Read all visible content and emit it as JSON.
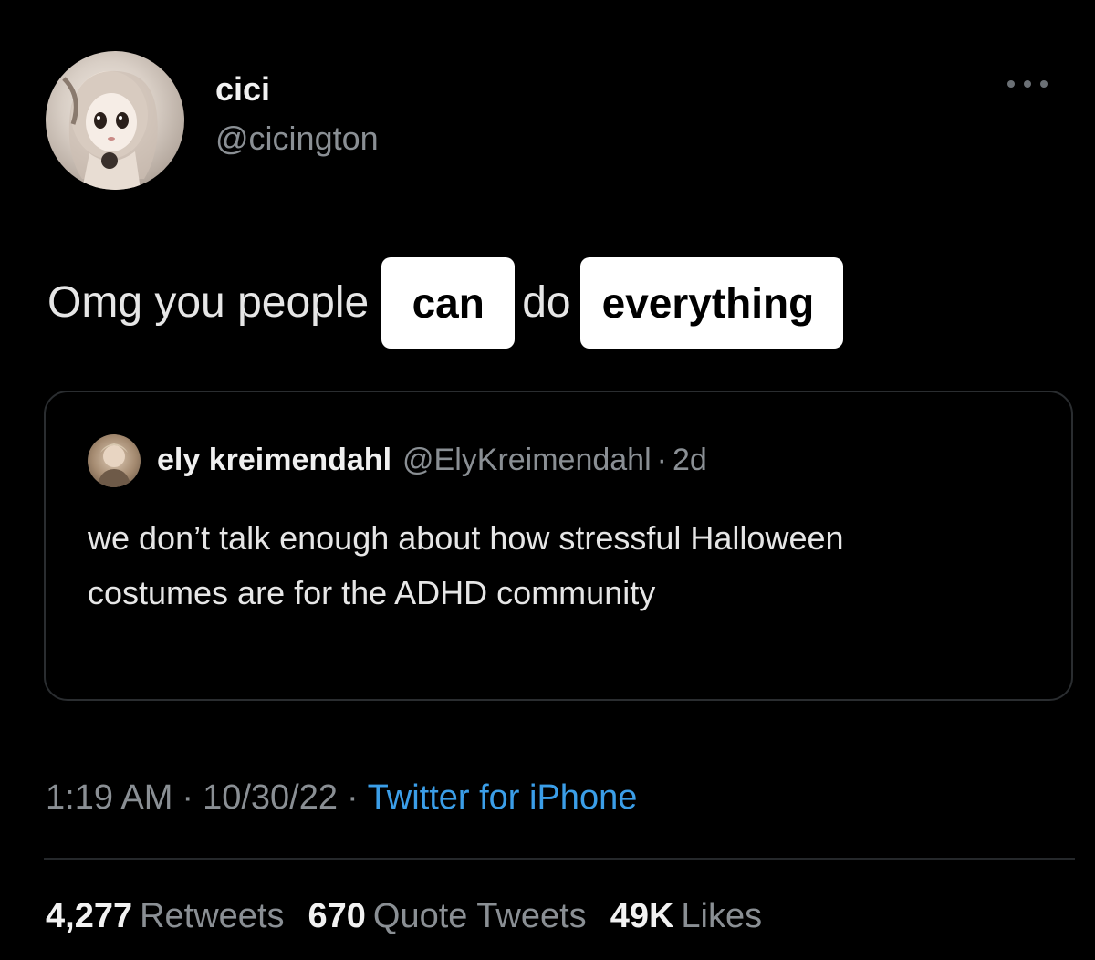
{
  "tweet": {
    "author": {
      "name": "cici",
      "handle": "@cicington",
      "avatar_icon": "avatar-photo"
    },
    "more_icon": "more-options-icon",
    "text": {
      "part1": "Omg you people",
      "highlight1": "can",
      "part2": "do",
      "highlight2": "everything"
    },
    "quoted": {
      "name": "ely kreimendahl",
      "handle": "@ElyKreimendahl",
      "separator": "·",
      "time": "2d",
      "body": "we don’t talk enough about how stressful Halloween costumes are for the ADHD community"
    },
    "meta": {
      "time": "1:19 AM",
      "dot1": "·",
      "date": "10/30/22",
      "dot2": "·",
      "source": "Twitter for iPhone"
    },
    "stats": {
      "retweets_count": "4,277",
      "retweets_label": "Retweets",
      "quotes_count": "670",
      "quotes_label": "Quote Tweets",
      "likes_count": "49K",
      "likes_label": "Likes"
    },
    "colors": {
      "background": "#000000",
      "link": "#3b9ee8",
      "muted": "#8a8f94",
      "highlight_bg": "#ffffff"
    }
  }
}
